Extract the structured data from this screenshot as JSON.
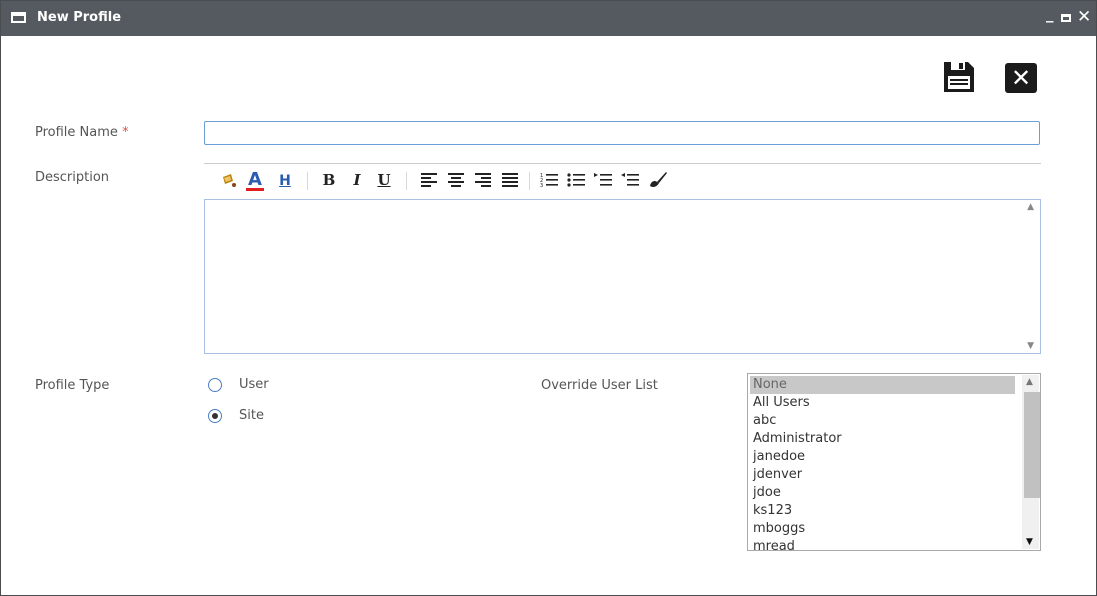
{
  "window": {
    "title": "New Profile",
    "controls": {
      "minimize": "_",
      "close": "✕"
    }
  },
  "toolbar": {
    "save_icon": "save-icon",
    "close_icon": "close-icon",
    "close_glyph": "✕"
  },
  "form": {
    "profile_name": {
      "label": "Profile Name",
      "required_marker": "*",
      "value": ""
    },
    "description": {
      "label": "Description",
      "value": "",
      "toolbar": [
        {
          "name": "clean-formatting-icon",
          "glyph": "🖌"
        },
        {
          "name": "font-color-icon",
          "glyph": "A"
        },
        {
          "name": "highlight-color-icon",
          "glyph": "H"
        },
        {
          "name": "bold-icon",
          "glyph": "B"
        },
        {
          "name": "italic-icon",
          "glyph": "I"
        },
        {
          "name": "underline-icon",
          "glyph": "U"
        },
        {
          "name": "align-left-icon",
          "glyph": "≡"
        },
        {
          "name": "align-center-icon",
          "glyph": "≡"
        },
        {
          "name": "align-right-icon",
          "glyph": "≡"
        },
        {
          "name": "align-justify-icon",
          "glyph": "≡"
        },
        {
          "name": "ordered-list-icon",
          "glyph": "☰"
        },
        {
          "name": "unordered-list-icon",
          "glyph": "☰"
        },
        {
          "name": "indent-icon",
          "glyph": "☰"
        },
        {
          "name": "outdent-icon",
          "glyph": "☰"
        },
        {
          "name": "format-painter-icon",
          "glyph": "✔"
        }
      ]
    },
    "profile_type": {
      "label": "Profile Type",
      "options": [
        {
          "label": "User",
          "selected": false
        },
        {
          "label": "Site",
          "selected": true
        }
      ]
    },
    "override_user_list": {
      "label": "Override User List",
      "items": [
        "None",
        "All Users",
        "abc",
        "Administrator",
        "janedoe",
        "jdenver",
        "jdoe",
        "ks123",
        "mboggs",
        "mread"
      ],
      "selected": "None"
    }
  },
  "colors": {
    "titlebar": "#545a5f",
    "input_focus_border": "#6a9ed8",
    "required": "#d9534f"
  }
}
